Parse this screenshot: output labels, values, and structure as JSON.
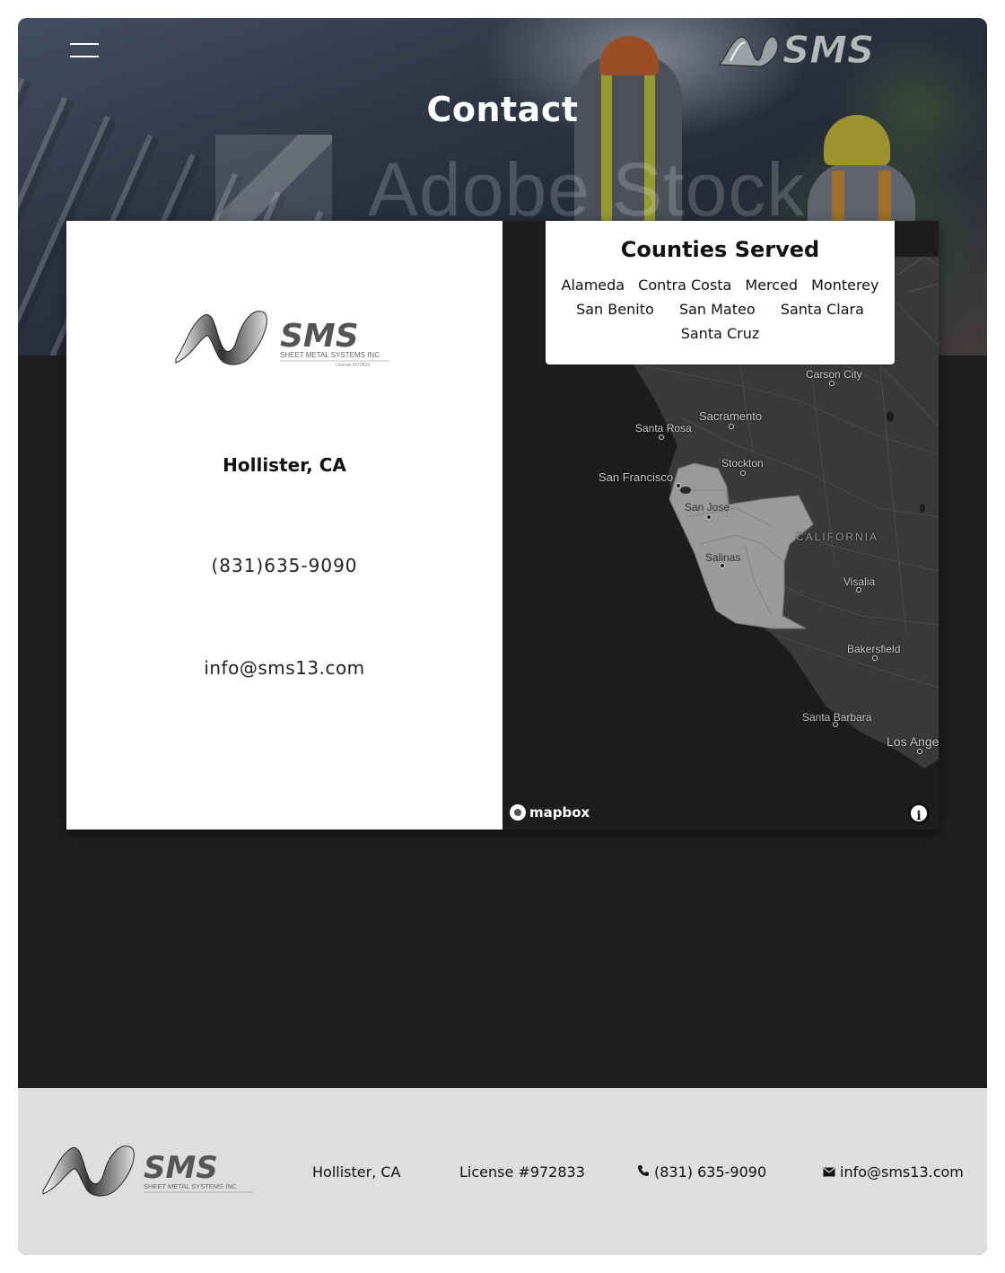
{
  "page": {
    "title": "Contact"
  },
  "header": {
    "brand_logo_text": "SMS",
    "menu_icon": "hamburger-icon"
  },
  "hero": {
    "watermark_text": "Adobe Stock"
  },
  "contact": {
    "logo_text": "SMS",
    "logo_subtitle": "SHEET METAL SYSTEMS INC",
    "logo_license": "License #972833",
    "location": "Hollister, CA",
    "phone": "(831)635-9090",
    "email": "info@sms13.com"
  },
  "counties": {
    "title": "Counties Served",
    "row1": [
      "Alameda",
      "Contra Costa",
      "Merced",
      "Monterey"
    ],
    "row2": [
      "San Benito",
      "San Mateo",
      "Santa Clara"
    ],
    "row3": [
      "Santa Cruz"
    ]
  },
  "map": {
    "labels": {
      "carson_city": "Carson City",
      "sacramento": "Sacramento",
      "santa_rosa": "Santa Rosa",
      "stockton": "Stockton",
      "san_francisco": "San Francisco",
      "san_jose": "San Jose",
      "california": "CALIFORNIA",
      "salinas": "Salinas",
      "visalia": "Visalia",
      "bakersfield": "Bakersfield",
      "santa_barbara": "Santa Barbara",
      "los_angeles": "Los Ange"
    },
    "attribution_logo": "mapbox",
    "info_button": "i",
    "colors": {
      "background": "#1d1d1d",
      "land": "#3a3a3a",
      "highlight": "#9a9a9a"
    }
  },
  "footer": {
    "logo_text": "SMS",
    "logo_subtitle": "SHEET METAL SYSTEMS INC",
    "location": "Hollister, CA",
    "license": "License #972833",
    "phone": "(831) 635-9090",
    "email": "info@sms13.com",
    "phone_icon": "phone-icon",
    "email_icon": "envelope-icon"
  }
}
